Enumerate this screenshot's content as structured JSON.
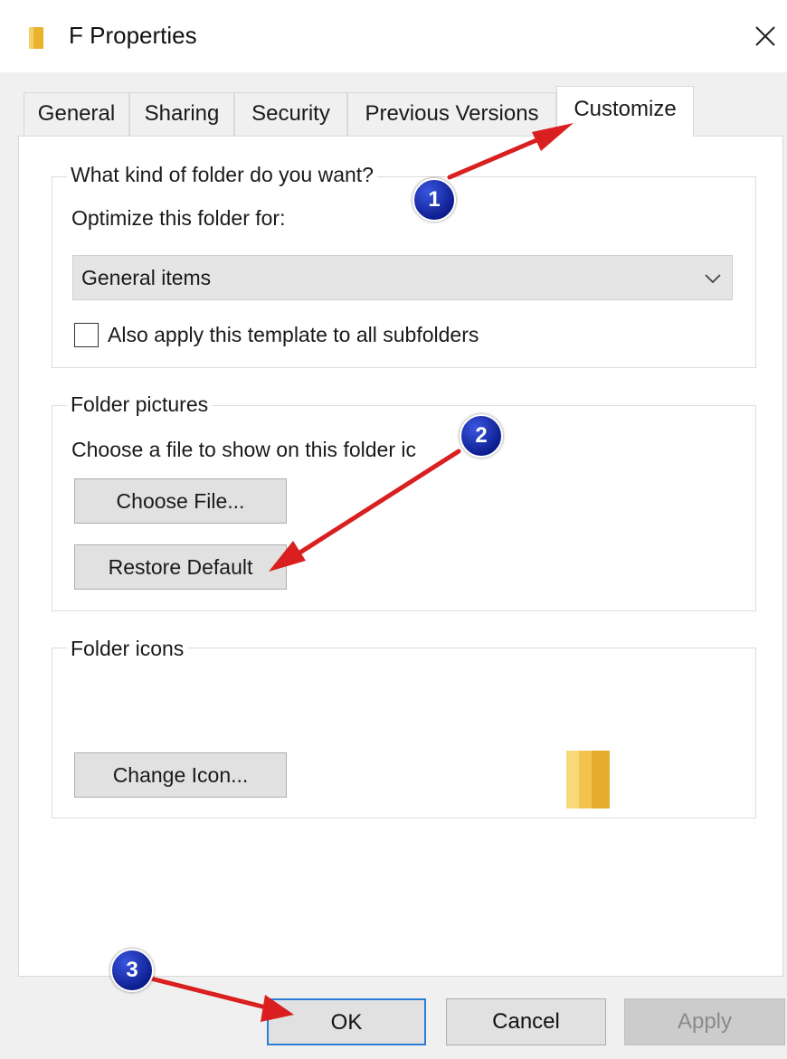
{
  "window": {
    "title": "F Properties",
    "close_glyph": "✕",
    "icon": "folder-icon"
  },
  "tabs": [
    {
      "label": "General",
      "active": false
    },
    {
      "label": "Sharing",
      "active": false
    },
    {
      "label": "Security",
      "active": false
    },
    {
      "label": "Previous Versions",
      "active": false
    },
    {
      "label": "Customize",
      "active": true
    }
  ],
  "folder_type": {
    "legend": "What kind of folder do you want?",
    "optimize_label": "Optimize this folder for:",
    "select_value": "General items",
    "checkbox_label": "Also apply this template to all subfolders",
    "checkbox_checked": false
  },
  "folder_pictures": {
    "legend": "Folder pictures",
    "description": "Choose a file to show on this folder ic",
    "choose_file_button": "Choose File...",
    "restore_default_button": "Restore Default"
  },
  "folder_icons": {
    "legend": "Folder icons",
    "change_icon_button": "Change Icon..."
  },
  "footer": {
    "ok_button": "OK",
    "cancel_button": "Cancel",
    "apply_button": "Apply",
    "apply_enabled": false
  },
  "annotations": {
    "step1": "1",
    "step2": "2",
    "step3": "3",
    "arrow_color": "#d91f1f",
    "badge_color": "#0a1a8a"
  },
  "colors": {
    "accent_focus": "#2b7fd6",
    "folder_yellow": "#f3c44d"
  }
}
